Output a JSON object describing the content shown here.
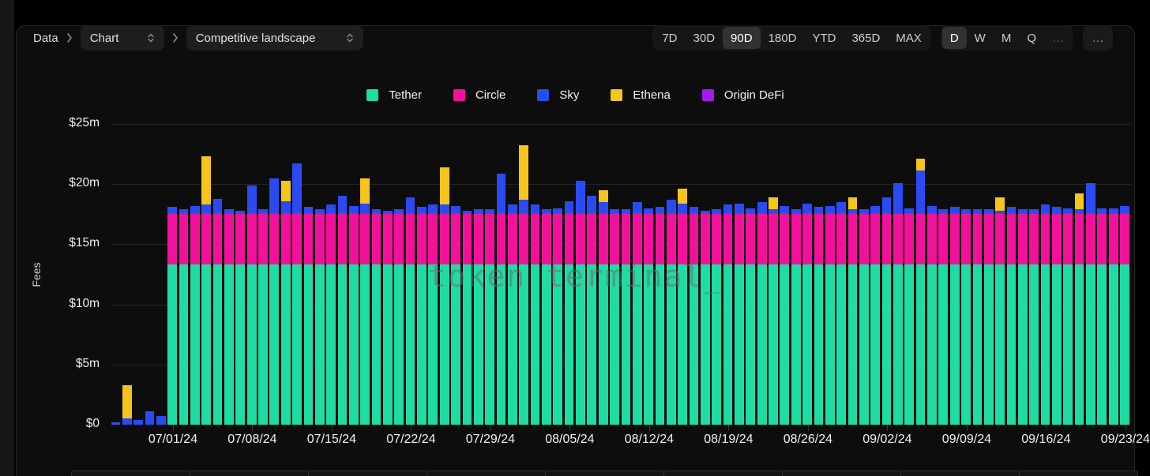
{
  "breadcrumb": {
    "root": "Data",
    "chart_selector": "Chart",
    "view_selector": "Competitive landscape"
  },
  "toolbar": {
    "ranges": [
      "7D",
      "30D",
      "90D",
      "180D",
      "YTD",
      "365D",
      "MAX"
    ],
    "selected_range": "90D",
    "granularities": [
      "D",
      "W",
      "M",
      "Q",
      "…"
    ],
    "selected_granularity": "D",
    "more": "…"
  },
  "watermark": "token terminal_",
  "chart_data": {
    "type": "bar",
    "stacked": true,
    "ylabel": "Fees",
    "ylim": [
      0,
      25
    ],
    "unit": "$m",
    "grid": true,
    "legend_position": "top-center",
    "y_tick_values": [
      0,
      5,
      10,
      15,
      20,
      25
    ],
    "y_tick_labels": [
      "$0",
      "$5m",
      "$10m",
      "$15m",
      "$20m",
      "$25m"
    ],
    "x_tick_labels": [
      "07/01/24",
      "07/08/24",
      "07/15/24",
      "07/22/24",
      "07/29/24",
      "08/05/24",
      "08/12/24",
      "08/19/24",
      "08/26/24",
      "09/02/24",
      "09/09/24",
      "09/16/24",
      "09/23/24"
    ],
    "legend": [
      {
        "name": "Tether",
        "color": "#1FDCA4"
      },
      {
        "name": "Circle",
        "color": "#F2119B"
      },
      {
        "name": "Sky",
        "color": "#2B4BF2"
      },
      {
        "name": "Ethena",
        "color": "#F5C51B"
      },
      {
        "name": "Origin DeFi",
        "color": "#A21BF2"
      }
    ],
    "stack_order": [
      "tether",
      "circle",
      "origin_defi",
      "sky",
      "ethena"
    ],
    "series_colors": {
      "tether": "#1FDCA4",
      "circle": "#F2119B",
      "origin_defi": "#A21BF2",
      "sky": "#2B4BF2",
      "ethena": "#F5C51B"
    },
    "bar_fields": [
      "date",
      "tether",
      "circle",
      "origin_defi",
      "sky",
      "ethena"
    ],
    "bars": [
      [
        "06/26/24",
        0,
        0,
        0,
        0.2,
        0
      ],
      [
        "06/27/24",
        0,
        0,
        0,
        0.5,
        2.8
      ],
      [
        "06/28/24",
        0,
        0,
        0,
        0.4,
        0
      ],
      [
        "06/29/24",
        0,
        0,
        0,
        1.1,
        0
      ],
      [
        "06/30/24",
        0,
        0,
        0,
        0.7,
        0
      ],
      [
        "07/01/24",
        13.3,
        4.2,
        0.1,
        0.5,
        0
      ],
      [
        "07/02/24",
        13.3,
        4.2,
        0.1,
        0.3,
        0
      ],
      [
        "07/03/24",
        13.3,
        4.2,
        0.1,
        0.6,
        0
      ],
      [
        "07/04/24",
        13.3,
        4.2,
        0.1,
        0.7,
        4.0
      ],
      [
        "07/05/24",
        13.3,
        4.2,
        0.1,
        1.2,
        0
      ],
      [
        "07/06/24",
        13.3,
        4.2,
        0.1,
        0.3,
        0
      ],
      [
        "07/07/24",
        13.3,
        4.2,
        0.1,
        0.2,
        0
      ],
      [
        "07/08/24",
        13.3,
        4.2,
        0.1,
        2.3,
        0
      ],
      [
        "07/09/24",
        13.3,
        4.2,
        0.1,
        0.3,
        0
      ],
      [
        "07/10/24",
        13.3,
        4.2,
        0.1,
        2.9,
        0
      ],
      [
        "07/11/24",
        13.3,
        4.2,
        0.1,
        1.0,
        1.7
      ],
      [
        "07/12/24",
        13.3,
        4.2,
        0.1,
        4.1,
        0
      ],
      [
        "07/13/24",
        13.3,
        4.2,
        0.1,
        0.5,
        0
      ],
      [
        "07/14/24",
        13.3,
        4.2,
        0.1,
        0.3,
        0
      ],
      [
        "07/15/24",
        13.3,
        4.2,
        0.1,
        0.7,
        0
      ],
      [
        "07/16/24",
        13.3,
        4.2,
        0.1,
        1.4,
        0
      ],
      [
        "07/17/24",
        13.3,
        4.2,
        0.1,
        0.6,
        0
      ],
      [
        "07/18/24",
        13.3,
        4.2,
        0.1,
        0.8,
        2.1
      ],
      [
        "07/19/24",
        13.3,
        4.2,
        0.1,
        0.3,
        0
      ],
      [
        "07/20/24",
        13.3,
        4.2,
        0.1,
        0.2,
        0
      ],
      [
        "07/21/24",
        13.3,
        4.2,
        0.1,
        0.3,
        0
      ],
      [
        "07/22/24",
        13.3,
        4.2,
        0.1,
        1.3,
        0
      ],
      [
        "07/23/24",
        13.3,
        4.2,
        0.1,
        0.5,
        0
      ],
      [
        "07/24/24",
        13.3,
        4.2,
        0.1,
        0.7,
        0
      ],
      [
        "07/25/24",
        13.3,
        4.2,
        0.1,
        0.7,
        3.1
      ],
      [
        "07/26/24",
        13.3,
        4.2,
        0.1,
        0.6,
        0
      ],
      [
        "07/27/24",
        13.3,
        4.2,
        0.1,
        0.2,
        0
      ],
      [
        "07/28/24",
        13.3,
        4.2,
        0.1,
        0.3,
        0
      ],
      [
        "07/29/24",
        13.3,
        4.2,
        0.1,
        0.3,
        0
      ],
      [
        "07/30/24",
        13.3,
        4.2,
        0.1,
        3.3,
        0
      ],
      [
        "07/31/24",
        13.3,
        4.2,
        0.1,
        0.7,
        0
      ],
      [
        "08/01/24",
        13.3,
        4.2,
        0.1,
        1.1,
        4.5
      ],
      [
        "08/02/24",
        13.3,
        4.2,
        0.1,
        0.7,
        0
      ],
      [
        "08/03/24",
        13.3,
        4.2,
        0.1,
        0.3,
        0
      ],
      [
        "08/04/24",
        13.3,
        4.2,
        0.1,
        0.4,
        0
      ],
      [
        "08/05/24",
        13.3,
        4.2,
        0.1,
        1.0,
        0
      ],
      [
        "08/06/24",
        13.3,
        4.2,
        0.1,
        2.7,
        0
      ],
      [
        "08/07/24",
        13.3,
        4.2,
        0.1,
        1.4,
        0
      ],
      [
        "08/08/24",
        13.3,
        4.2,
        0.1,
        0.9,
        1.0
      ],
      [
        "08/09/24",
        13.3,
        4.2,
        0.1,
        0.3,
        0
      ],
      [
        "08/10/24",
        13.3,
        4.2,
        0.1,
        0.3,
        0
      ],
      [
        "08/11/24",
        13.3,
        4.2,
        0.1,
        0.9,
        0
      ],
      [
        "08/12/24",
        13.3,
        4.2,
        0.1,
        0.4,
        0
      ],
      [
        "08/13/24",
        13.3,
        4.2,
        0.1,
        0.5,
        0
      ],
      [
        "08/14/24",
        13.3,
        4.2,
        0.1,
        1.1,
        0
      ],
      [
        "08/15/24",
        13.3,
        4.2,
        0.1,
        0.8,
        1.2
      ],
      [
        "08/16/24",
        13.3,
        4.2,
        0.1,
        0.5,
        0
      ],
      [
        "08/17/24",
        13.3,
        4.2,
        0.1,
        0.2,
        0
      ],
      [
        "08/18/24",
        13.3,
        4.2,
        0.1,
        0.3,
        0
      ],
      [
        "08/19/24",
        13.3,
        4.2,
        0.1,
        0.7,
        0
      ],
      [
        "08/20/24",
        13.3,
        4.2,
        0.1,
        0.8,
        0
      ],
      [
        "08/21/24",
        13.3,
        4.2,
        0.1,
        0.4,
        0
      ],
      [
        "08/22/24",
        13.3,
        4.2,
        0.1,
        0.9,
        0
      ],
      [
        "08/23/24",
        13.3,
        4.2,
        0.1,
        0.3,
        1.0
      ],
      [
        "08/24/24",
        13.3,
        4.2,
        0.1,
        0.6,
        0
      ],
      [
        "08/25/24",
        13.3,
        4.2,
        0.1,
        0.3,
        0
      ],
      [
        "08/26/24",
        13.3,
        4.2,
        0.1,
        0.8,
        0
      ],
      [
        "08/27/24",
        13.3,
        4.2,
        0.1,
        0.5,
        0
      ],
      [
        "08/28/24",
        13.3,
        4.2,
        0.1,
        0.6,
        0
      ],
      [
        "08/29/24",
        13.3,
        4.2,
        0.1,
        0.9,
        0
      ],
      [
        "08/30/24",
        13.3,
        4.2,
        0.1,
        0.3,
        1.0
      ],
      [
        "08/31/24",
        13.3,
        4.2,
        0.1,
        0.3,
        0
      ],
      [
        "09/01/24",
        13.3,
        4.2,
        0.1,
        0.6,
        0
      ],
      [
        "09/02/24",
        13.3,
        4.2,
        0.1,
        1.3,
        0
      ],
      [
        "09/03/24",
        13.3,
        4.2,
        0.1,
        2.5,
        0
      ],
      [
        "09/04/24",
        13.3,
        4.2,
        0.1,
        0.4,
        0
      ],
      [
        "09/05/24",
        13.3,
        4.2,
        0.1,
        3.5,
        1.0
      ],
      [
        "09/06/24",
        13.3,
        4.2,
        0.1,
        0.6,
        0
      ],
      [
        "09/07/24",
        13.3,
        4.2,
        0.1,
        0.3,
        0
      ],
      [
        "09/08/24",
        13.3,
        4.2,
        0.1,
        0.5,
        0
      ],
      [
        "09/09/24",
        13.3,
        4.2,
        0.1,
        0.3,
        0
      ],
      [
        "09/10/24",
        13.3,
        4.2,
        0.1,
        0.3,
        0
      ],
      [
        "09/11/24",
        13.3,
        4.2,
        0.1,
        0.3,
        0
      ],
      [
        "09/12/24",
        13.3,
        4.2,
        0.1,
        0.2,
        1.1
      ],
      [
        "09/13/24",
        13.3,
        4.2,
        0.1,
        0.5,
        0
      ],
      [
        "09/14/24",
        13.3,
        4.2,
        0.1,
        0.3,
        0
      ],
      [
        "09/15/24",
        13.3,
        4.2,
        0.1,
        0.3,
        0
      ],
      [
        "09/16/24",
        13.3,
        4.2,
        0.1,
        0.7,
        0
      ],
      [
        "09/17/24",
        13.3,
        4.2,
        0.1,
        0.5,
        0
      ],
      [
        "09/18/24",
        13.3,
        4.2,
        0.1,
        0.4,
        0
      ],
      [
        "09/19/24",
        13.3,
        4.2,
        0.1,
        0.3,
        1.3
      ],
      [
        "09/20/24",
        13.3,
        4.2,
        0.1,
        2.5,
        0
      ],
      [
        "09/21/24",
        13.3,
        4.2,
        0.1,
        0.4,
        0
      ],
      [
        "09/22/24",
        13.3,
        4.2,
        0.1,
        0.4,
        0
      ],
      [
        "09/23/24",
        13.3,
        4.2,
        0.1,
        0.6,
        0
      ]
    ]
  }
}
